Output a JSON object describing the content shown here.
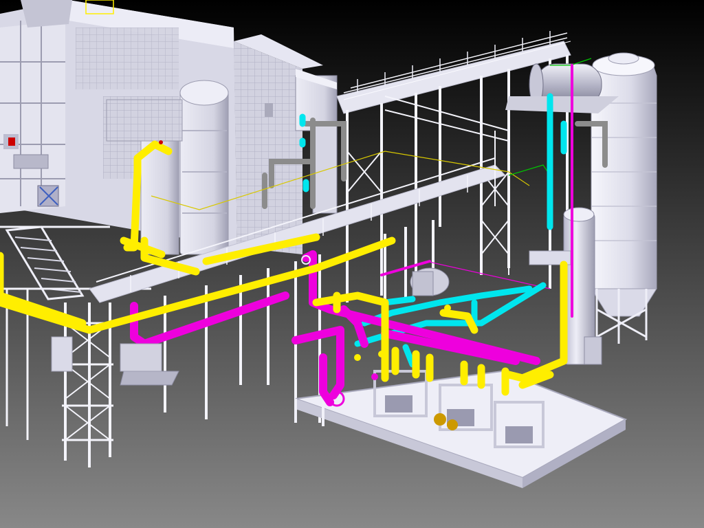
{
  "viewport": {
    "view": "3d-isometric-plant-model",
    "background": {
      "top_color": "#000000",
      "bottom_color": "#888888"
    }
  },
  "colors": {
    "structure_light": "#eeeef7",
    "structure_mid": "#c9c9d8",
    "structure_dark": "#9d9db2",
    "steel_outline": "#7a7a90",
    "pipe_yellow": "#ffee00",
    "pipe_magenta": "#ee00dd",
    "pipe_cyan": "#00e6ee",
    "pipe_gray": "#8c8c8c",
    "pipe_green": "#00c800",
    "valve_orange": "#cc9900",
    "flag_red": "#cc0000"
  },
  "model": {
    "objects": [
      {
        "kind": "boiler-building",
        "icon": "building-icon"
      },
      {
        "kind": "flue-duct-stack",
        "icon": "duct-icon"
      },
      {
        "kind": "pipe-rack",
        "icon": "rack-icon"
      },
      {
        "kind": "storage-silo",
        "icon": "silo-icon"
      },
      {
        "kind": "horizontal-drum",
        "icon": "drum-icon"
      },
      {
        "kind": "vertical-vessel",
        "icon": "vessel-icon"
      },
      {
        "kind": "pump-skid",
        "icon": "pump-icon"
      }
    ],
    "pipe_systems": [
      "yellow",
      "magenta",
      "cyan",
      "gray",
      "green"
    ]
  }
}
